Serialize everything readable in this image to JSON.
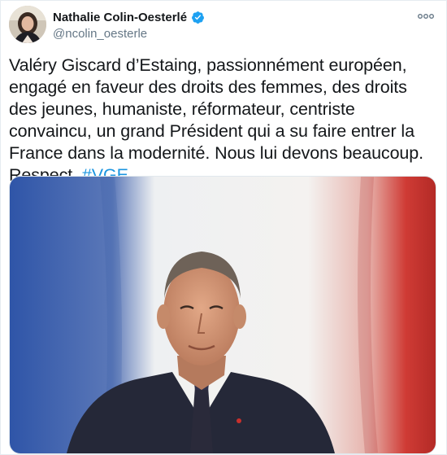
{
  "author": {
    "display_name": "Nathalie Colin-Oesterlé",
    "handle": "@ncolin_oesterle",
    "verified_icon": "verified-badge-icon",
    "avatar_icon": "profile-avatar"
  },
  "tweet": {
    "text": "Valéry Giscard d’Estaing, passionnément européen, engagé en faveur des droits des femmes, des droits des jeunes, humaniste, réformateur, centriste convaincu, un grand Président qui a su faire entrer la France dans la modernité. Nous lui devons beaucoup. Respect. ",
    "hashtag": "#VGE"
  },
  "media": {
    "description_icon": "official-portrait-photo"
  },
  "colors": {
    "text": "#14171a",
    "secondary": "#657786",
    "link": "#1b95e0",
    "verified": "#1da1f2",
    "flag_blue": "#2b4fa0",
    "flag_red": "#c8302c"
  }
}
